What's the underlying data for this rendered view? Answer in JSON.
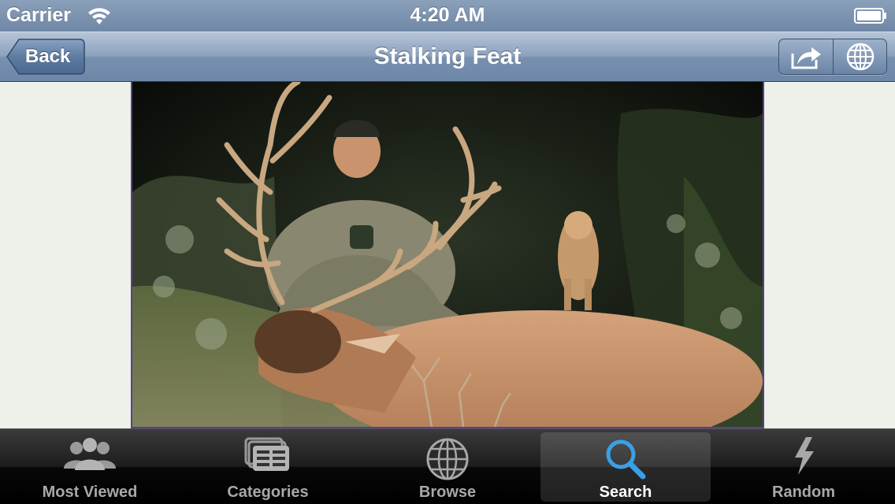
{
  "status_bar": {
    "carrier": "Carrier",
    "time": "4:20 AM",
    "icons": [
      "wifi-icon",
      "battery-icon"
    ]
  },
  "nav_bar": {
    "title": "Stalking Feat",
    "back_label": "Back",
    "actions": [
      "share-icon",
      "globe-icon"
    ]
  },
  "content": {
    "image_subject": "hunter with elk at night, mountain lion in background"
  },
  "tab_bar": {
    "selected": "Search",
    "tabs": [
      {
        "label": "Most Viewed",
        "icon": "people-icon"
      },
      {
        "label": "Categories",
        "icon": "categories-icon"
      },
      {
        "label": "Browse",
        "icon": "globe-icon"
      },
      {
        "label": "Search",
        "icon": "search-icon"
      },
      {
        "label": "Random",
        "icon": "lightning-icon"
      }
    ]
  },
  "colors": {
    "nav_tint": "#7890b0",
    "content_bg": "#edf1ea",
    "frame_border": "#5a3f93",
    "tab_bar": "#1c1c1c",
    "selected_icon": "#3aa0e6"
  }
}
